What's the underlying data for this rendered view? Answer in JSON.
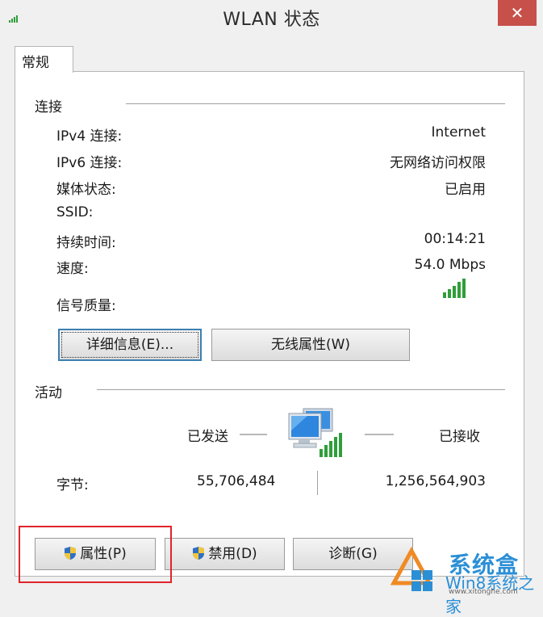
{
  "window": {
    "title": "WLAN 状态",
    "close": "✕"
  },
  "tab": {
    "label": "常规"
  },
  "connection": {
    "group_label": "连接",
    "rows": [
      {
        "label": "IPv4 连接:",
        "value": "Internet"
      },
      {
        "label": "IPv6 连接:",
        "value": "无网络访问权限"
      },
      {
        "label": "媒体状态:",
        "value": "已启用"
      },
      {
        "label": "SSID:",
        "value": ""
      },
      {
        "label": "持续时间:",
        "value": "00:14:21"
      },
      {
        "label": "速度:",
        "value": "54.0 Mbps"
      }
    ],
    "signal_label": "信号质量:",
    "signal_bars": 5,
    "details_button": "详细信息(E)...",
    "wireless_button": "无线属性(W)"
  },
  "activity": {
    "group_label": "活动",
    "sent_label": "已发送",
    "received_label": "已接收",
    "bytes_label": "字节:",
    "bytes_sent": "55,706,484",
    "bytes_received": "1,256,564,903",
    "icon": "network-computers-icon"
  },
  "buttons": {
    "properties": "属性(P)",
    "disable": "禁用(D)",
    "diagnose": "诊断(G)"
  },
  "watermark": {
    "brand": "系统盒",
    "sub": "Win8系统之家",
    "url": "www.xitonghe.com"
  },
  "colors": {
    "signal": "#2f9e3a",
    "highlight": "#e0242b",
    "close": "#c7504a",
    "accent": "#3c7fb1"
  }
}
